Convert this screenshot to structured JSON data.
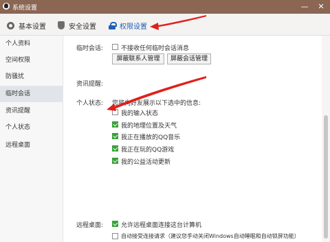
{
  "window": {
    "title": "系统设置",
    "minimize": "—",
    "close": "✕"
  },
  "tabs": [
    {
      "label": "基本设置",
      "icon": "gear-icon"
    },
    {
      "label": "安全设置",
      "icon": "shield-icon"
    },
    {
      "label": "权限设置",
      "icon": "lock-icon",
      "active": true
    }
  ],
  "sidebar": {
    "items": [
      {
        "label": "个人资料"
      },
      {
        "label": "空间权限"
      },
      {
        "label": "防骚扰"
      },
      {
        "label": "临时会话",
        "active": true
      },
      {
        "label": "资讯提醒"
      },
      {
        "label": "个人状态"
      },
      {
        "label": "远程桌面"
      }
    ]
  },
  "temp_chat": {
    "label": "临时会话:",
    "option": {
      "label": "不接收任何临时会话消息",
      "checked": false
    },
    "buttons": [
      "屏蔽联系人管理",
      "屏蔽会话管理"
    ]
  },
  "news": {
    "label": "资讯提醒:"
  },
  "status": {
    "label": "个人状态:",
    "intro": "您将向好友展示以下选中的信息:",
    "options": [
      {
        "label": "我的输入状态",
        "checked": false
      },
      {
        "label": "我的地理位置及天气",
        "checked": true
      },
      {
        "label": "我正在播放的QQ音乐",
        "checked": true
      },
      {
        "label": "我正在玩的QQ游戏",
        "checked": true
      },
      {
        "label": "我的公益活动更新",
        "checked": true
      }
    ]
  },
  "remote": {
    "label": "远程桌面:",
    "options": [
      {
        "label": "允许远程桌面连接这台计算机",
        "checked": true
      },
      {
        "label": "自动接受连接请求（建议您手动关闭Windows自动睡眠和自动锁屏功能）",
        "checked": false
      }
    ]
  },
  "annotation_color": "#e0201a"
}
